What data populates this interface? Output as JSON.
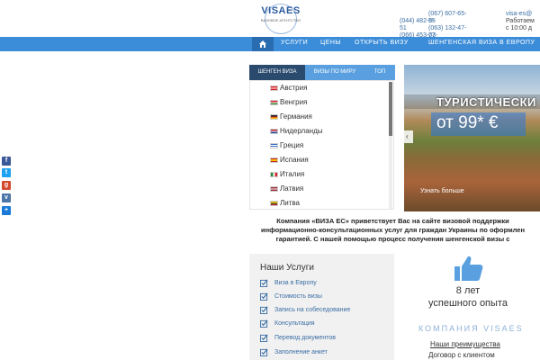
{
  "header": {
    "logo_title": "VISAES",
    "logo_sub": "ВИЗОВОЕ АГЕНТСТВО",
    "phone1": "(044) 482-8-51",
    "phone2": "(066) 453-03-33",
    "phone3": "(067) 607-65-55",
    "phone4": "(063) 132-47-77",
    "email": "visa-es@",
    "hours1": "Работаем",
    "hours2": "с 10:00 д"
  },
  "nav": {
    "items": [
      "УСЛУГИ",
      "ЦЕНЫ",
      "ОТКРЫТЬ ВИЗУ",
      "ШЕНГЕНСКАЯ ВИЗА В ЕВРОПУ"
    ]
  },
  "tabs": [
    "ШЕНГЕН ВИЗА",
    "ВИЗЫ ПО МИРУ",
    "ТОП"
  ],
  "countries": [
    "Австрия",
    "Венгрия",
    "Германия",
    "Нидерланды",
    "Греция",
    "Испания",
    "Италия",
    "Латвия",
    "Литва"
  ],
  "slider": {
    "title": "ТУРИСТИЧЕСКИ",
    "price": "от 99* €",
    "more": "Узнать больше"
  },
  "intro": {
    "line1": "Компания «ВИЗА ЕС» приветствует Вас на сайте визовой поддержки",
    "line2": "информационно-консультационных услуг для граждан Украины по оформлен",
    "line3": "гарантией. С нашей помощью процесс получения шенгенской визы с"
  },
  "services": {
    "title": "Наши Услуги",
    "items": [
      "Виза в Европу",
      "Стоимость визы",
      "Запись на собеседование",
      "Консультация",
      "Перевод документов",
      "Заполнение анкет"
    ]
  },
  "stats": {
    "years_line1": "8 лет",
    "years_line2": "успешного опыта",
    "company": "КОМПАНИЯ VISAES",
    "link1": "Наши преимущества",
    "link2": "Договор с клиентом"
  },
  "colors": {
    "nav_bg": "#3c8dd9",
    "tab_active": "#2a4a6e",
    "tab_inactive": "#5aa0e0",
    "accent_link": "#3a6ea5"
  }
}
